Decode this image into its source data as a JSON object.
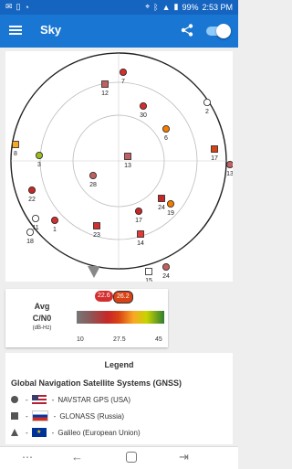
{
  "status_bar": {
    "time": "2:53 PM",
    "battery": "99%",
    "icons": [
      "email-icon",
      "vibrate-icon",
      "wifi-icon",
      "location-icon",
      "bluetooth-icon",
      "signal-icon",
      "battery-icon"
    ]
  },
  "app_bar": {
    "title": "Sky",
    "icons": [
      "menu-icon",
      "share-icon"
    ],
    "toggle_on": true
  },
  "sky_view": {
    "satellites": [
      {
        "id": "7",
        "shape": "circle",
        "color": "#d32f2f"
      },
      {
        "id": "12",
        "shape": "square",
        "color": "#c06060"
      },
      {
        "id": "30",
        "shape": "circle",
        "color": "#d32f2f"
      },
      {
        "id": "2",
        "shape": "circle",
        "color": "#ffffff"
      },
      {
        "id": "6",
        "shape": "circle",
        "color": "#f57c00"
      },
      {
        "id": "8",
        "shape": "square",
        "color": "#f9a825"
      },
      {
        "id": "3",
        "shape": "circle",
        "color": "#9bbb22"
      },
      {
        "id": "13",
        "shape": "square",
        "color": "#c06060"
      },
      {
        "id": "17",
        "shape": "square",
        "color": "#d84315"
      },
      {
        "id": "28",
        "shape": "circle",
        "color": "#c06060"
      },
      {
        "id": "22",
        "shape": "circle",
        "color": "#c62828"
      },
      {
        "id": "11",
        "shape": "circle",
        "color": "#ffffff"
      },
      {
        "id": "1",
        "shape": "circle",
        "color": "#d32f2f"
      },
      {
        "id": "24",
        "shape": "square",
        "color": "#c62828"
      },
      {
        "id": "19",
        "shape": "circle",
        "color": "#f57c00"
      },
      {
        "id": "17",
        "shape": "circle",
        "color": "#c62828"
      },
      {
        "id": "23",
        "shape": "square",
        "color": "#d32f2f"
      },
      {
        "id": "14",
        "shape": "square",
        "color": "#e53935"
      },
      {
        "id": "18",
        "shape": "circle",
        "color": "#ffffff"
      },
      {
        "id": "15",
        "shape": "square",
        "color": "#ffffff"
      },
      {
        "id": "24",
        "shape": "circle",
        "color": "#c06060"
      },
      {
        "id": "13",
        "shape": "circle",
        "color": "#c06060"
      }
    ]
  },
  "cn0": {
    "label_lines": [
      "Avg",
      "C/N0",
      "(dB-Hz)"
    ],
    "ticks": [
      "10",
      "27.5",
      "45"
    ],
    "bubbles": [
      {
        "value": "22.6",
        "color": "#d32f2f"
      },
      {
        "value": "26.2",
        "color": "#d84315"
      }
    ]
  },
  "legend": {
    "title": "Legend",
    "subtitle": "Global Navigation Satellite Systems (GNSS)",
    "rows": [
      {
        "shape": "circle",
        "flag": "us-flag-icon",
        "text": "NAVSTAR GPS (USA)"
      },
      {
        "shape": "square",
        "flag": "russia-flag-icon",
        "text": "GLONASS (Russia)"
      },
      {
        "shape": "triangle",
        "flag": "eu-flag-icon",
        "text": "Galileo (European Union)"
      }
    ],
    "separator": "-"
  },
  "nav_bar": {
    "icons": [
      "recent-apps-icon",
      "back-icon",
      "home-icon",
      "overview-icon"
    ]
  }
}
